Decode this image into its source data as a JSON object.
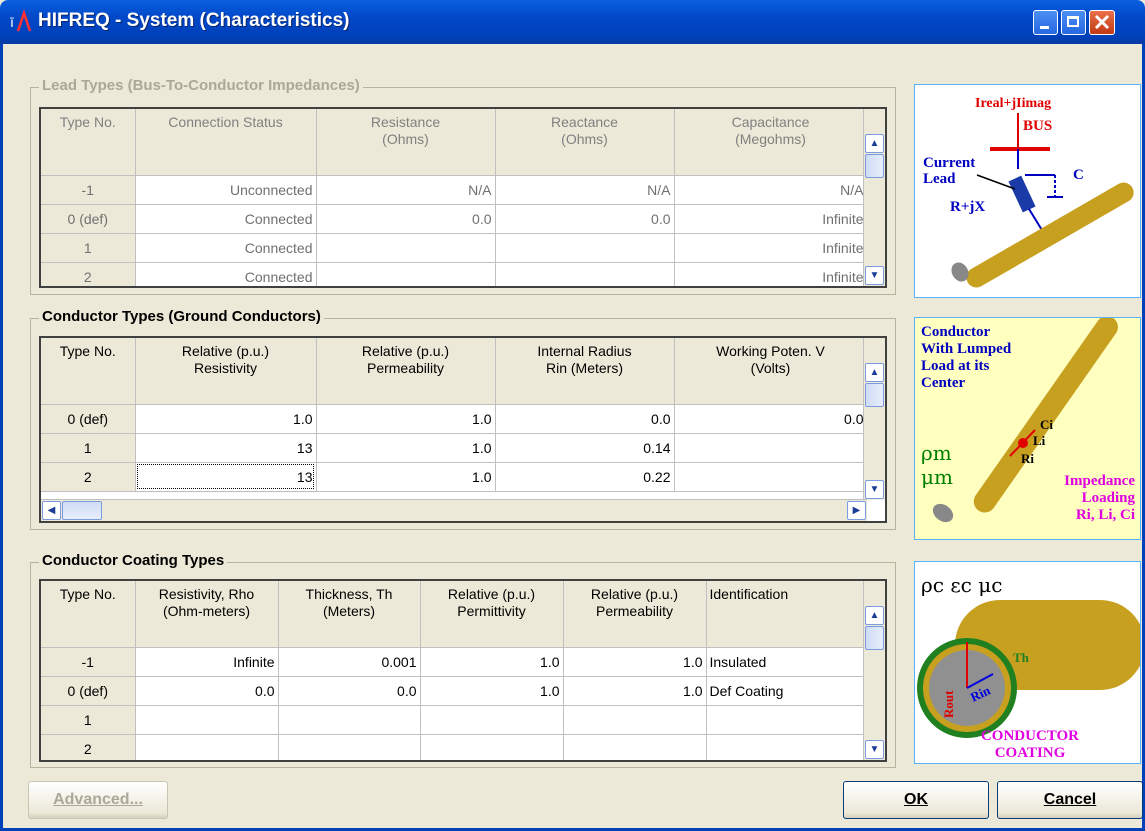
{
  "window": {
    "title": "HIFREQ - System (Characteristics)",
    "colors": {
      "titlebar": "#0048c8",
      "face": "#ece9d8"
    }
  },
  "lead_types": {
    "label": "Lead Types (Bus-To-Conductor Impedances)",
    "columns": [
      "Type No.",
      "Connection Status",
      "Resistance (Ohms)",
      "Reactance (Ohms)",
      "Capacitance (Megohms)"
    ],
    "rows": [
      {
        "type": "-1",
        "status": "Unconnected",
        "resistance": "N/A",
        "reactance": "N/A",
        "capacitance": "N/A"
      },
      {
        "type": "0 (def)",
        "status": "Connected",
        "resistance": "0.0",
        "reactance": "0.0",
        "capacitance": "Infinite"
      },
      {
        "type": "1",
        "status": "Connected",
        "resistance": "",
        "reactance": "",
        "capacitance": "Infinite"
      },
      {
        "type": "2",
        "status": "Connected",
        "resistance": "",
        "reactance": "",
        "capacitance": "Infinite"
      }
    ]
  },
  "conductor_types": {
    "label": "Conductor Types (Ground Conductors)",
    "columns": [
      "Type No.",
      "Relative (p.u.) Resistivity",
      "Relative (p.u.) Permeability",
      "Internal Radius Rin (Meters)",
      "Working Poten. V (Volts)"
    ],
    "rows": [
      {
        "type": "0 (def)",
        "resistivity": "1.0",
        "permeability": "1.0",
        "radius": "0.0",
        "potential": "0.0"
      },
      {
        "type": "1",
        "resistivity": "13",
        "permeability": "1.0",
        "radius": "0.14",
        "potential": ""
      },
      {
        "type": "2",
        "resistivity": "13",
        "permeability": "1.0",
        "radius": "0.22",
        "potential": ""
      }
    ]
  },
  "coating_types": {
    "label": "Conductor Coating Types",
    "columns": [
      "Type No.",
      "Resistivity, Rho (Ohm-meters)",
      "Thickness, Th (Meters)",
      "Relative (p.u.) Permittivity",
      "Relative (p.u.) Permeability",
      "Identification"
    ],
    "rows": [
      {
        "type": "-1",
        "rho": "Infinite",
        "th": "0.001",
        "perm": "1.0",
        "mu": "1.0",
        "id": "Insulated"
      },
      {
        "type": "0 (def)",
        "rho": "0.0",
        "th": "0.0",
        "perm": "1.0",
        "mu": "1.0",
        "id": "Def Coating"
      },
      {
        "type": "1",
        "rho": "",
        "th": "",
        "perm": "",
        "mu": "",
        "id": ""
      },
      {
        "type": "2",
        "rho": "",
        "th": "",
        "perm": "",
        "mu": "",
        "id": ""
      }
    ]
  },
  "pictures": {
    "lead": {
      "ireal": "Ireal+jIimag",
      "bus": "BUS",
      "current": "Current",
      "lead": "Lead",
      "c": "C",
      "rjx": "R+jX"
    },
    "conductor": {
      "line1": "Conductor",
      "line2": "With Lumped",
      "line3": "Load at its",
      "line4": "Center",
      "ci": "Ci",
      "li": "Li",
      "ri": "Ri",
      "rho": "ρm",
      "mu": "μm",
      "imp1": "Impedance",
      "imp2": "Loading",
      "imp3": "Ri, Li, Ci"
    },
    "coating": {
      "symbols": "ρc εc μc",
      "th": "Th",
      "rout": "Rout",
      "rin": "Rin",
      "caption1": "CONDUCTOR",
      "caption2": "COATING"
    }
  },
  "buttons": {
    "advanced": "Advanced...",
    "ok": "OK",
    "cancel": "Cancel"
  }
}
